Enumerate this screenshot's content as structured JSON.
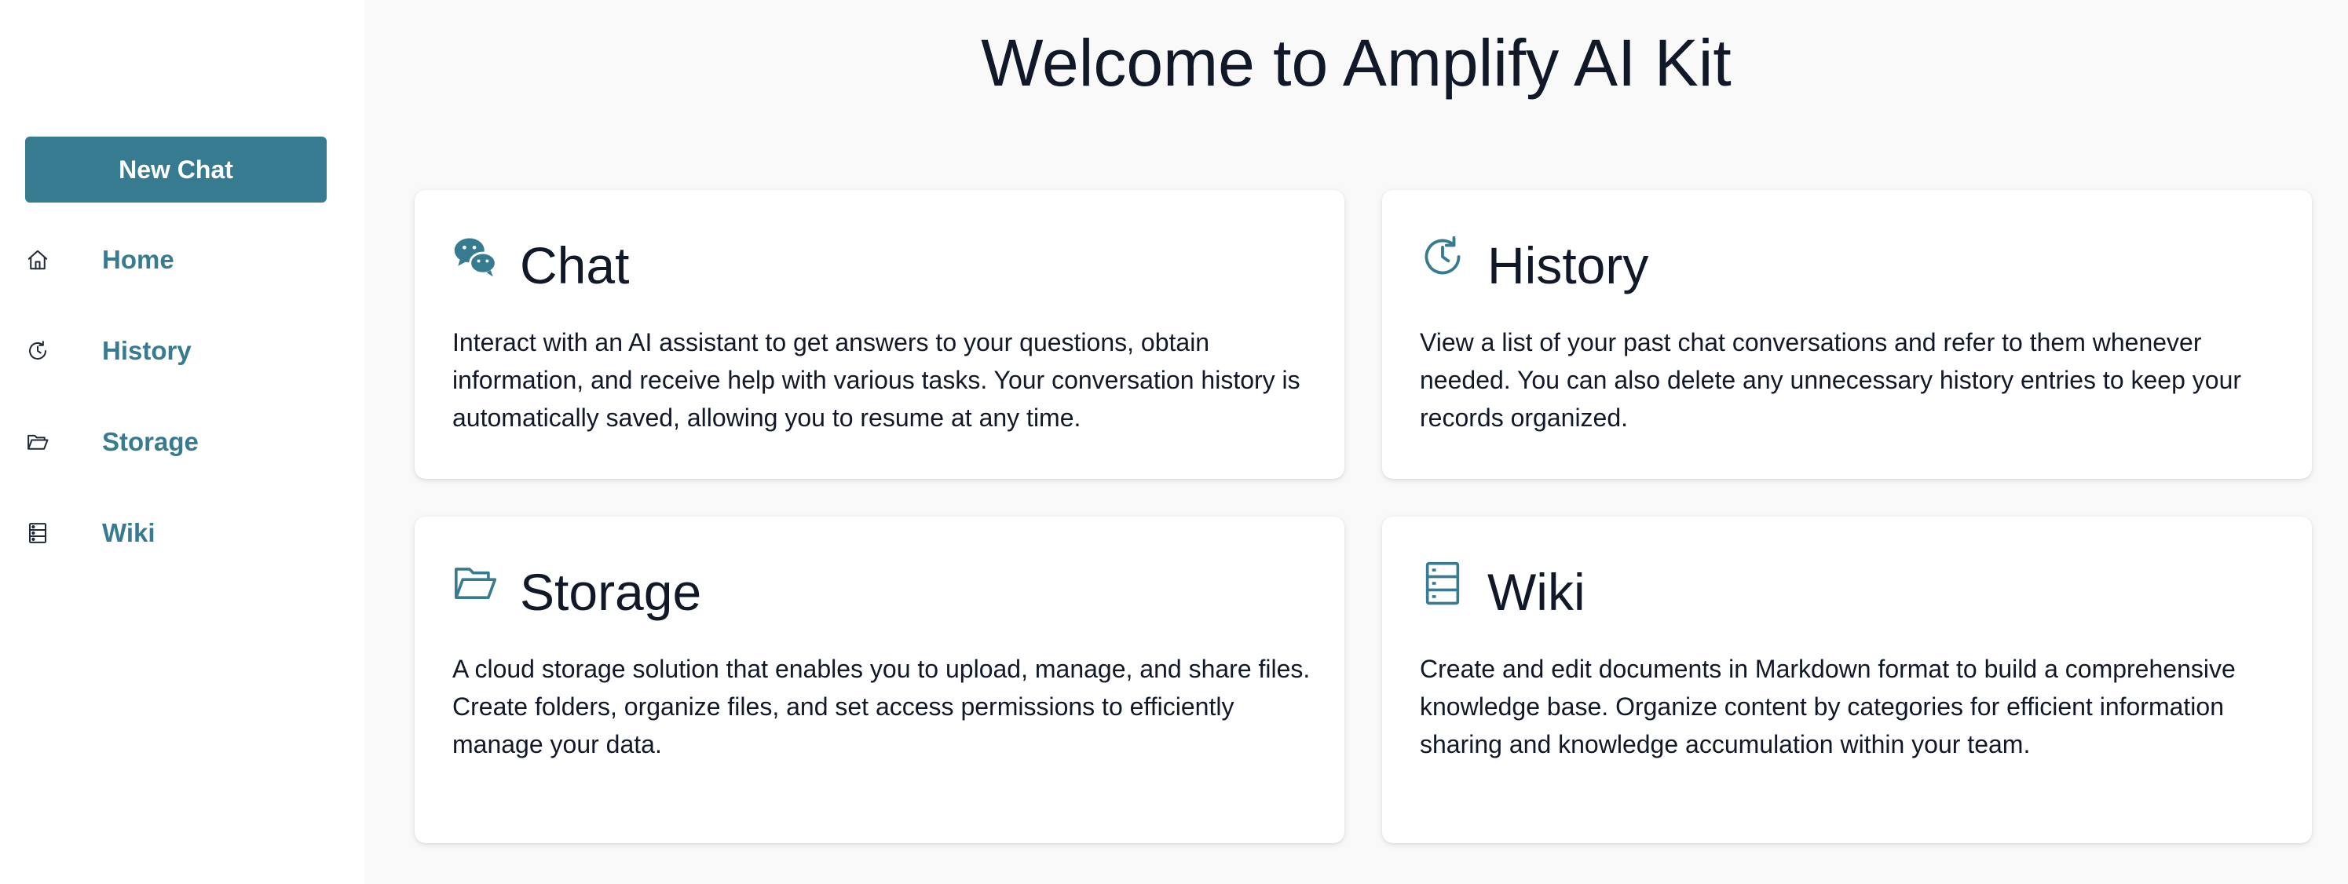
{
  "sidebar": {
    "new_chat_label": "New Chat",
    "items": [
      {
        "label": "Home",
        "icon": "home-icon"
      },
      {
        "label": "History",
        "icon": "history-icon"
      },
      {
        "label": "Storage",
        "icon": "folder-icon"
      },
      {
        "label": "Wiki",
        "icon": "wiki-icon"
      }
    ]
  },
  "main": {
    "title": "Welcome to Amplify AI Kit",
    "cards": [
      {
        "title": "Chat",
        "icon": "chat-icon",
        "description": "Interact with an AI assistant to get answers to your questions, obtain information, and receive help with various tasks. Your conversation history is automatically saved, allowing you to resume at any time."
      },
      {
        "title": "History",
        "icon": "history-icon",
        "description": "View a list of your past chat conversations and refer to them whenever needed. You can also delete any unnecessary history entries to keep your records organized."
      },
      {
        "title": "Storage",
        "icon": "folder-icon",
        "description": "A cloud storage solution that enables you to upload, manage, and share files. Create folders, organize files, and set access permissions to efficiently manage your data."
      },
      {
        "title": "Wiki",
        "icon": "wiki-icon",
        "description": "Create and edit documents in Markdown format to build a comprehensive knowledge base. Organize content by categories for efficient information sharing and knowledge accumulation within your team."
      }
    ]
  },
  "colors": {
    "accent": "#377b91",
    "background": "#f9f9f9",
    "sidebar_bg": "#ffffff",
    "text": "#111827"
  }
}
